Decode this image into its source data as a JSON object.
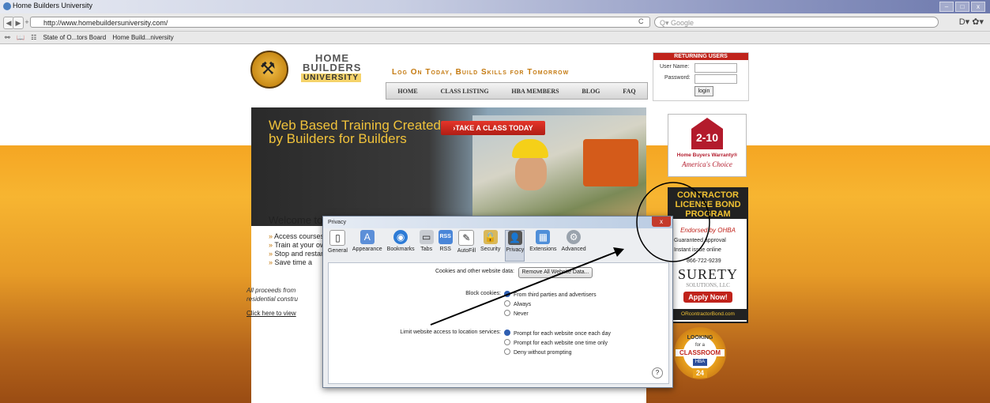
{
  "browser": {
    "window_title": "Home Builders University",
    "url": "http://www.homebuildersuniversity.com/",
    "search_placeholder": "Q▾ Google",
    "back_glyph": "◀",
    "forward_glyph": "▶",
    "add_glyph": "+",
    "reload_glyph": "C",
    "page_menu_glyph": "D▾",
    "settings_glyph": "✿▾",
    "bookmarks": [
      "State of O...tors Board",
      "Home Build...niversity"
    ]
  },
  "site": {
    "logo": {
      "line1": "HOME",
      "line2": "BUILDERS",
      "line3": "UNIVERSITY"
    },
    "tagline": "Log On Today, Build Skills for Tomorrow",
    "nav": [
      "HOME",
      "CLASS LISTING",
      "HBA MEMBERS",
      "BLOG",
      "FAQ"
    ],
    "login": {
      "header": "RETURNING USERS",
      "username_label": "User Name:",
      "password_label": "Password:",
      "button": "login"
    },
    "hero_title_1": "Web Based Training Created",
    "hero_title_2": "by Builders for Builders",
    "take_class": "›TAKE A CLASS TODAY",
    "welcome": "Welcome to Home Builders University",
    "bullets": [
      "Access courses anytime, anywhere online",
      "Train at your own pace",
      "Stop and restart a course whenever necessary",
      "Save time a"
    ],
    "proceeds_1": "All proceeds from",
    "proceeds_2": "residential constru",
    "click_here": "Click here to view",
    "ad_warranty": {
      "logo": "2-10",
      "line1": "Home Buyers Warranty®",
      "line2": "America's Choice"
    },
    "ad_bond": {
      "header": "CONTRACTOR LICENSE BOND PROGRAM",
      "endorsed": "Endorsed by OHBA",
      "line1": "Guaranteed approval",
      "line2": "Instant issue online",
      "phone": "866-722-9239",
      "brand": "SURETY",
      "brand_sub": "SOLUTIONS, LLC",
      "apply": "Apply Now!",
      "site": "ORcontractorBond.com"
    },
    "ad_classroom": {
      "l1": "LOOKING",
      "l2": "for a",
      "l3": "CLASSROOM",
      "l4": "HBA",
      "l5": "24"
    }
  },
  "dialog": {
    "title": "Privacy",
    "close": "x",
    "tabs": [
      {
        "label": "General",
        "icon": "general-icon",
        "glyph": "▯"
      },
      {
        "label": "Appearance",
        "icon": "appearance-icon",
        "glyph": "A"
      },
      {
        "label": "Bookmarks",
        "icon": "bookmarks-icon",
        "glyph": "◉"
      },
      {
        "label": "Tabs",
        "icon": "tabs-icon",
        "glyph": "▭"
      },
      {
        "label": "RSS",
        "icon": "rss-icon",
        "glyph": "RSS"
      },
      {
        "label": "AutoFill",
        "icon": "autofill-icon",
        "glyph": "✎"
      },
      {
        "label": "Security",
        "icon": "lock-icon",
        "glyph": "🔒"
      },
      {
        "label": "Privacy",
        "icon": "privacy-icon",
        "glyph": "👤"
      },
      {
        "label": "Extensions",
        "icon": "extensions-icon",
        "glyph": "▦"
      },
      {
        "label": "Advanced",
        "icon": "gear-icon",
        "glyph": "⚙"
      }
    ],
    "cookies_label": "Cookies and other website data:",
    "remove_button": "Remove All Website Data...",
    "block_label": "Block cookies:",
    "block_options": [
      "From third parties and advertisers",
      "Always",
      "Never"
    ],
    "location_label": "Limit website access to location services:",
    "location_options": [
      "Prompt for each website once each day",
      "Prompt for each website one time only",
      "Deny without prompting"
    ],
    "help": "?"
  }
}
